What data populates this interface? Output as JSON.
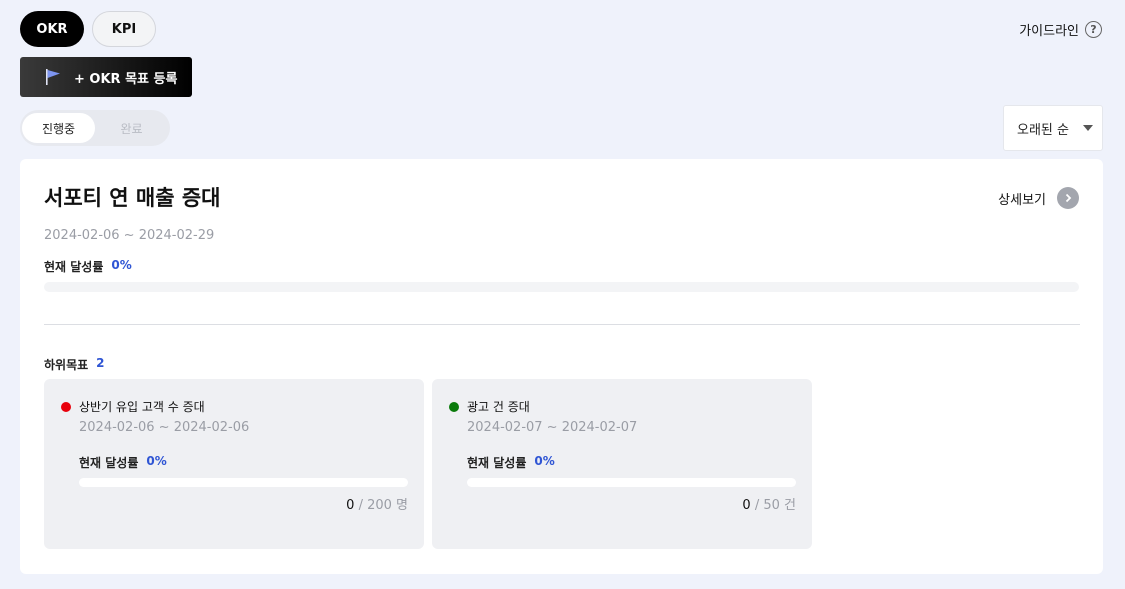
{
  "tabs": {
    "okr": "OKR",
    "kpi": "KPI"
  },
  "guide": {
    "label": "가이드라인",
    "icon": "help-circle-icon"
  },
  "register_button": {
    "label": "+ OKR 목표 등록",
    "icon": "flag-icon"
  },
  "status_filter": {
    "active": "진행중",
    "inactive": "완료"
  },
  "sort": {
    "selected": "오래된 순"
  },
  "objective": {
    "title": "서포티 연 매출 증대",
    "detail_label": "상세보기",
    "date_range": "2024-02-06 ~ 2024-02-29",
    "rate_label": "현재 달성률",
    "rate_value": "0%",
    "progress": 0,
    "sub_label": "하위목표",
    "sub_count": "2"
  },
  "key_results": [
    {
      "title": "상반기 유입 고객 수 증대",
      "status_color": "#e8000b",
      "date_range": "2024-02-06 ~ 2024-02-06",
      "rate_label": "현재 달성률",
      "rate_value": "0%",
      "progress": 0,
      "current": "0",
      "target": "/ 200 명"
    },
    {
      "title": "광고 건 증대",
      "status_color": "#0a7a0a",
      "date_range": "2024-02-07 ~ 2024-02-07",
      "rate_label": "현재 달성률",
      "rate_value": "0%",
      "progress": 0,
      "current": "0",
      "target": "/ 50 건"
    }
  ],
  "colors": {
    "accent": "#2f55d4",
    "background": "#eff2fb"
  }
}
